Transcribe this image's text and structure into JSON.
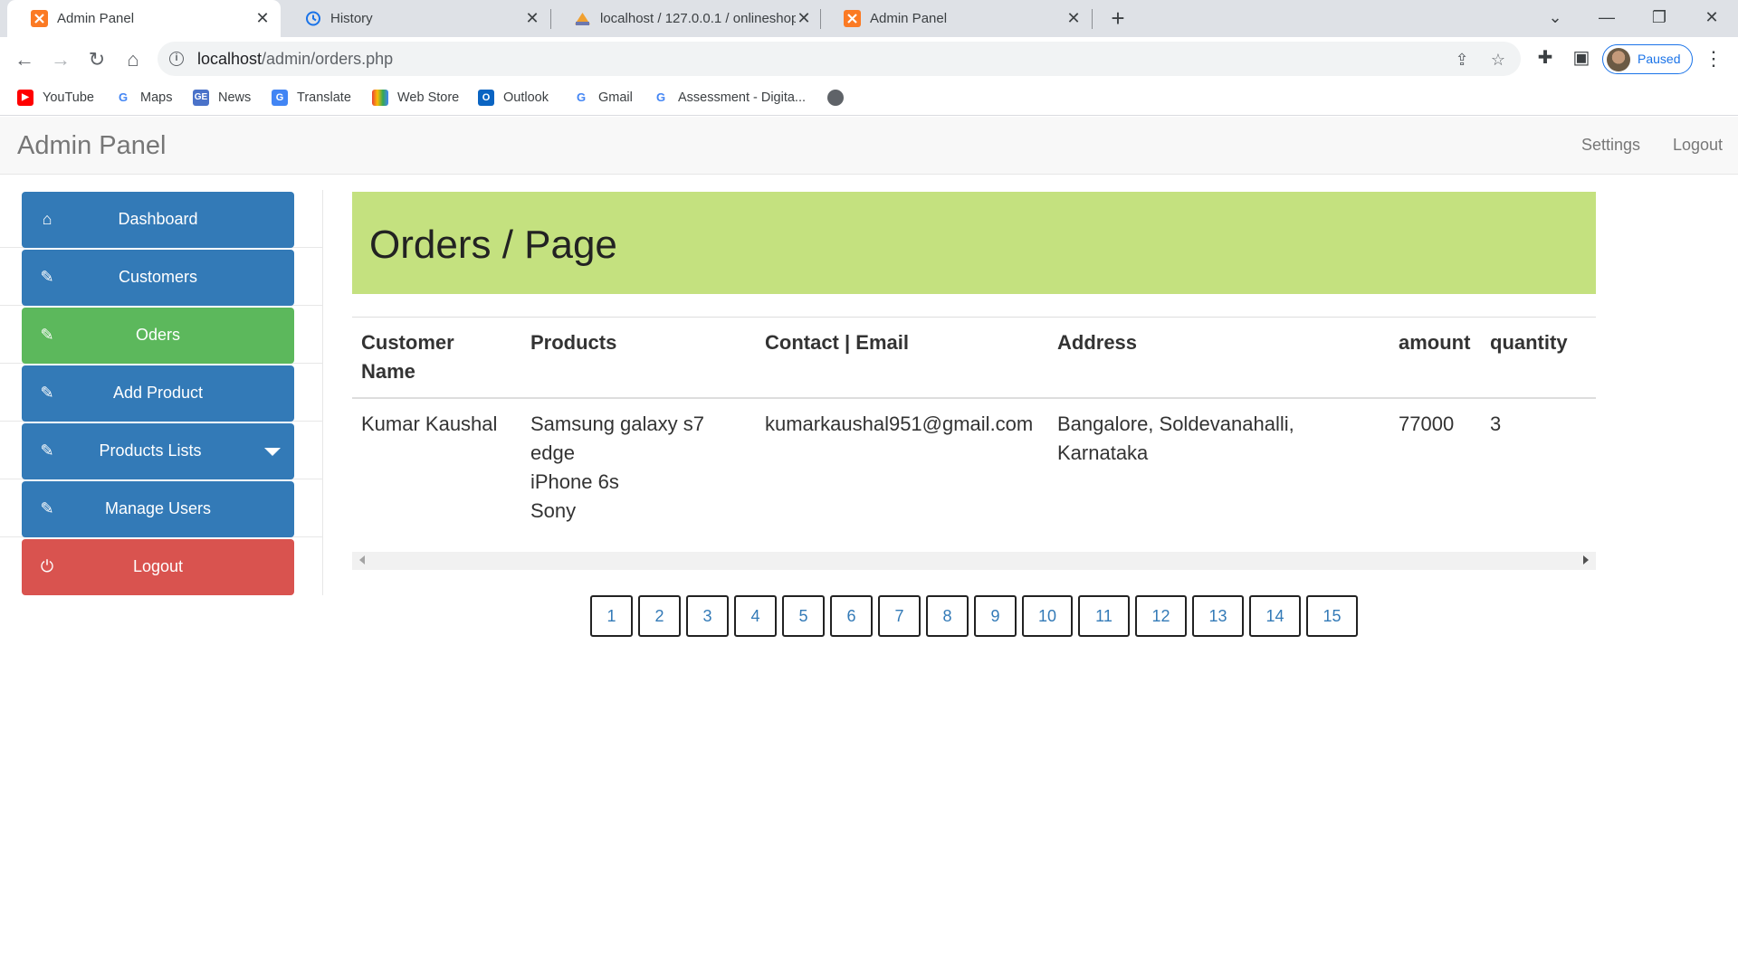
{
  "browser": {
    "tabs": [
      {
        "title": "Admin Panel",
        "icon": "xampp-icon",
        "active": true
      },
      {
        "title": "History",
        "icon": "history-icon",
        "active": false
      },
      {
        "title": "localhost / 127.0.0.1 / onlineshop",
        "icon": "phpmyadmin-icon",
        "active": false
      },
      {
        "title": "Admin Panel",
        "icon": "xampp-icon",
        "active": false
      }
    ],
    "url_host": "localhost",
    "url_path": "/admin/orders.php",
    "profile_status": "Paused",
    "bookmarks": [
      {
        "label": "YouTube",
        "icon": "youtube-icon"
      },
      {
        "label": "Maps",
        "icon": "google-icon"
      },
      {
        "label": "News",
        "icon": "news-icon"
      },
      {
        "label": "Translate",
        "icon": "translate-icon"
      },
      {
        "label": "Web Store",
        "icon": "webstore-icon"
      },
      {
        "label": "Outlook",
        "icon": "outlook-icon"
      },
      {
        "label": "Gmail",
        "icon": "google-icon"
      },
      {
        "label": "Assessment - Digita...",
        "icon": "google-icon"
      }
    ]
  },
  "navbar": {
    "brand": "Admin Panel",
    "settings": "Settings",
    "logout": "Logout"
  },
  "sidebar": {
    "items": [
      {
        "label": "Dashboard",
        "icon": "home-icon",
        "color": "#337ab7"
      },
      {
        "label": "Customers",
        "icon": "edit-icon",
        "color": "#337ab7"
      },
      {
        "label": "Oders",
        "icon": "edit-icon",
        "color": "#5cb85c"
      },
      {
        "label": "Add Product",
        "icon": "edit-icon",
        "color": "#337ab7"
      },
      {
        "label": "Products Lists",
        "icon": "edit-icon",
        "color": "#337ab7"
      },
      {
        "label": "Manage Users",
        "icon": "edit-icon",
        "color": "#337ab7"
      },
      {
        "label": "Logout",
        "icon": "power-icon",
        "color": "#d9534f"
      }
    ]
  },
  "main": {
    "header_title": "Orders / Page",
    "header_color": "#c4e17f",
    "table": {
      "headers": {
        "customer_line1": "Customer",
        "customer_line2": "Name",
        "products": "Products",
        "contact": "Contact | Email",
        "address": "Address",
        "amount": "amount",
        "quantity": "quantity"
      },
      "rows": [
        {
          "customer": "Kumar Kaushal",
          "product1": "Samsung galaxy s7",
          "product1_cont": "edge",
          "product2": "iPhone 6s",
          "product3": "Sony",
          "email": "kumarkaushal951@gmail.com",
          "address1": "Bangalore, Soldevanahalli,",
          "address2": "Karnataka",
          "amount": "77000",
          "quantity": "3"
        }
      ]
    },
    "pagination": [
      "1",
      "2",
      "3",
      "4",
      "5",
      "6",
      "7",
      "8",
      "9",
      "10",
      "11",
      "12",
      "13",
      "14",
      "15"
    ]
  }
}
